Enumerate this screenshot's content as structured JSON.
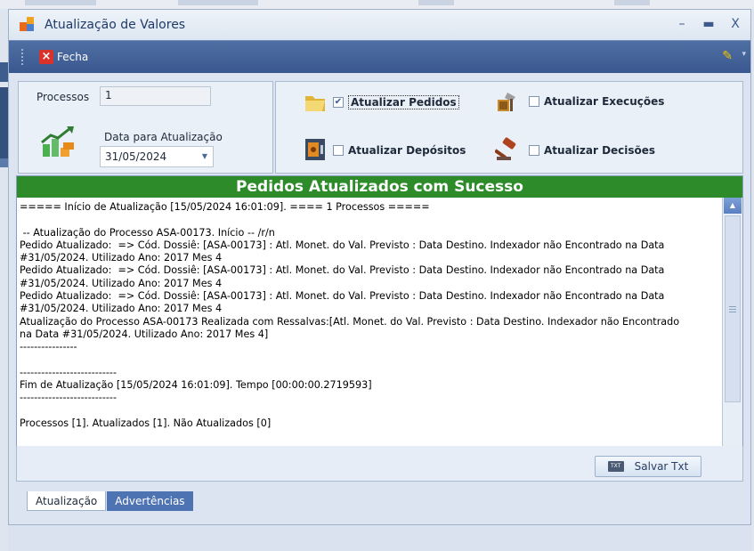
{
  "window": {
    "title": "Atualização de Valores",
    "controls": {
      "minimize": "–",
      "maximize": "▬",
      "close": "X"
    }
  },
  "toolbar": {
    "close_label": "Fecha"
  },
  "form": {
    "processos_label": "Processos",
    "processos_value": "1",
    "data_label": "Data para Atualização",
    "data_value": "31/05/2024"
  },
  "options": [
    {
      "label": "Atualizar Pedidos",
      "checked": true
    },
    {
      "label": "Atualizar Execuções",
      "checked": false
    },
    {
      "label": "Atualizar Depósitos",
      "checked": false
    },
    {
      "label": "Atualizar Decisões",
      "checked": false
    }
  ],
  "result": {
    "header": "Pedidos Atualizados com Sucesso",
    "log_lines": [
      "===== Início de Atualização [15/05/2024 16:01:09]. ==== 1 Processos =====",
      "",
      " -- Atualização do Processo ASA-00173. Início -- /r/n",
      "Pedido Atualizado:  => Cód. Dossiê: [ASA-00173] : Atl. Monet. do Val. Previsto : Data Destino. Indexador não Encontrado na Data",
      "#31/05/2024. Utilizado Ano: 2017 Mes 4",
      "Pedido Atualizado:  => Cód. Dossiê: [ASA-00173] : Atl. Monet. do Val. Previsto : Data Destino. Indexador não Encontrado na Data",
      "#31/05/2024. Utilizado Ano: 2017 Mes 4",
      "Pedido Atualizado:  => Cód. Dossiê: [ASA-00173] : Atl. Monet. do Val. Previsto : Data Destino. Indexador não Encontrado na Data",
      "#31/05/2024. Utilizado Ano: 2017 Mes 4",
      "Atualização do Processo ASA-00173 Realizada com Ressalvas:[Atl. Monet. do Val. Previsto : Data Destino. Indexador não Encontrado",
      "na Data #31/05/2024. Utilizado Ano: 2017 Mes 4]",
      "----------------",
      "",
      "---------------------------",
      "Fim de Atualização [15/05/2024 16:01:09]. Tempo [00:00:00.2719593]",
      "---------------------------",
      "",
      "Processos [1]. Atualizados [1]. Não Atualizados [0]"
    ]
  },
  "actions": {
    "save_txt_label": "Salvar Txt",
    "txt_icon_text": "TXT"
  },
  "tabs": [
    {
      "label": "Atualização",
      "active": true
    },
    {
      "label": "Advertências",
      "active": false
    }
  ],
  "colors": {
    "success_header": "#2e8b2a",
    "toolbar": "#3a5890",
    "tab_inactive": "#4e73b2"
  }
}
